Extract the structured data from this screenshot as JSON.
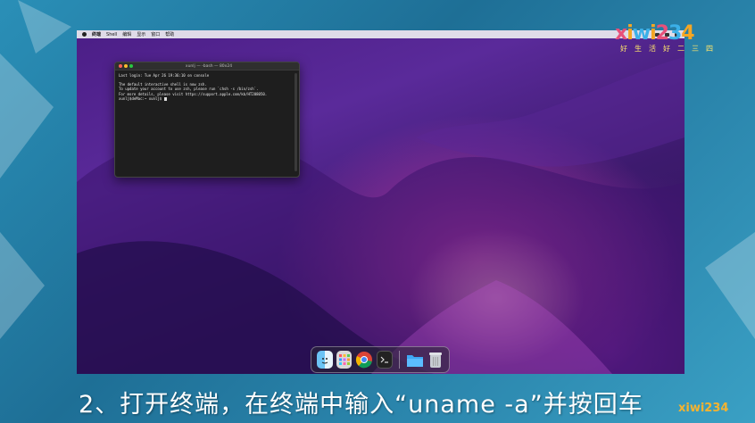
{
  "menubar": {
    "items": [
      "终端",
      "Shell",
      "编辑",
      "显示",
      "窗口",
      "帮助"
    ]
  },
  "terminal": {
    "title": "xunlj — -bash — 80x24",
    "lines": [
      "Last login: Tue Apr 26 19:36:10 on console",
      "",
      "The default interactive shell is now zsh.",
      "To update your account to use zsh, please run `chsh -s /bin/zsh`.",
      "For more details, please visit https://support.apple.com/kb/HT208050.",
      "xunlj$deMac:~ xunlj$"
    ]
  },
  "dock": {
    "icons": [
      "finder-icon",
      "launchpad-icon",
      "chrome-icon",
      "terminal-icon",
      "folder-icon",
      "trash-icon"
    ]
  },
  "logo": {
    "main": "xiwi234",
    "sub": "好生活好二三四"
  },
  "caption": "2、打开终端，在终端中输入“uname -a”并按回车",
  "colors": {
    "accent_orange": "#f5a623",
    "accent_pink": "#e8507a",
    "accent_blue": "#3bb0e8"
  }
}
